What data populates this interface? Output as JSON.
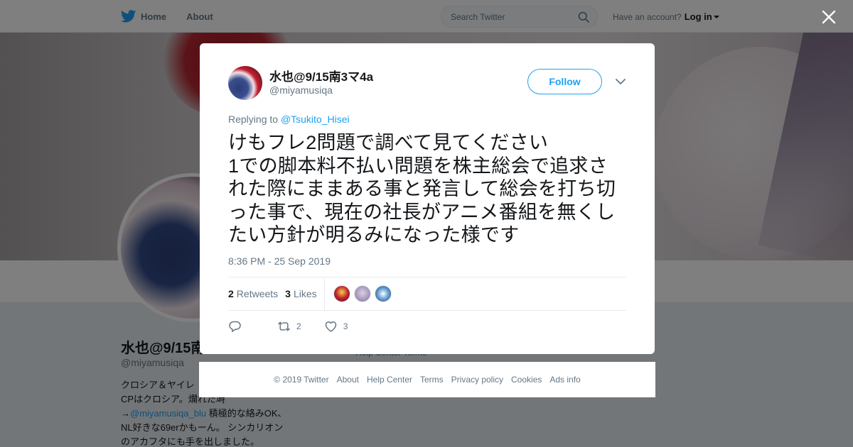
{
  "nav": {
    "home_label": "Home",
    "about_label": "About",
    "search_placeholder": "Search Twitter",
    "have_account": "Have an account?",
    "login_label": "Log in"
  },
  "profile": {
    "name": "水也@9/15南",
    "handle": "@miyamusiqa",
    "bio_line1": "クロシア＆ヤイレ",
    "bio_line2": "CPはクロシア。爛れた塒",
    "bio_arrow": "→",
    "bio_link": "@miyamusiqa_blu",
    "bio_line3_rest": " 積極的な絡みOK、",
    "bio_line4": "NL好きな69erかもーん。 シンカリオン",
    "bio_line5": "のアカフタにも手を出しました。",
    "under_links": "Help Center   Terms"
  },
  "tweet": {
    "author_name": "水也@9/15南3マ4a",
    "author_handle": "@miyamusiqa",
    "follow_label": "Follow",
    "replying_prefix": "Replying to",
    "replying_to": "@Tsukito_Hisei",
    "text": "けもフレ2問題で調べて見てください\n1での脚本料不払い問題を株主総会で追求さ\nれた際にままある事と発言して総会を打ち切\nった事で、現在の社長がアニメ番組を無くし\nたい方針が明るみになった様です",
    "timestamp": "8:36 PM - 25 Sep 2019",
    "retweets_count": "2",
    "retweets_label": "Retweets",
    "likes_count": "3",
    "likes_label": "Likes",
    "action_retweet_count": "2",
    "action_like_count": "3",
    "likers": [
      {
        "color": "#b81e2a"
      },
      {
        "color": "#b7a9c9"
      },
      {
        "color": "#3d6fa8"
      }
    ]
  },
  "footer": {
    "copyright": "© 2019 Twitter",
    "about": "About",
    "help_center": "Help Center",
    "terms": "Terms",
    "privacy": "Privacy policy",
    "cookies": "Cookies",
    "ads_info": "Ads info"
  },
  "colors": {
    "twitter_blue": "#1da1f2",
    "text_primary": "#14171a",
    "text_secondary": "#657786"
  },
  "icons": [
    "twitter-bird-icon",
    "search-icon",
    "close-icon",
    "chevron-down-icon",
    "reply-icon",
    "retweet-icon",
    "like-icon"
  ]
}
